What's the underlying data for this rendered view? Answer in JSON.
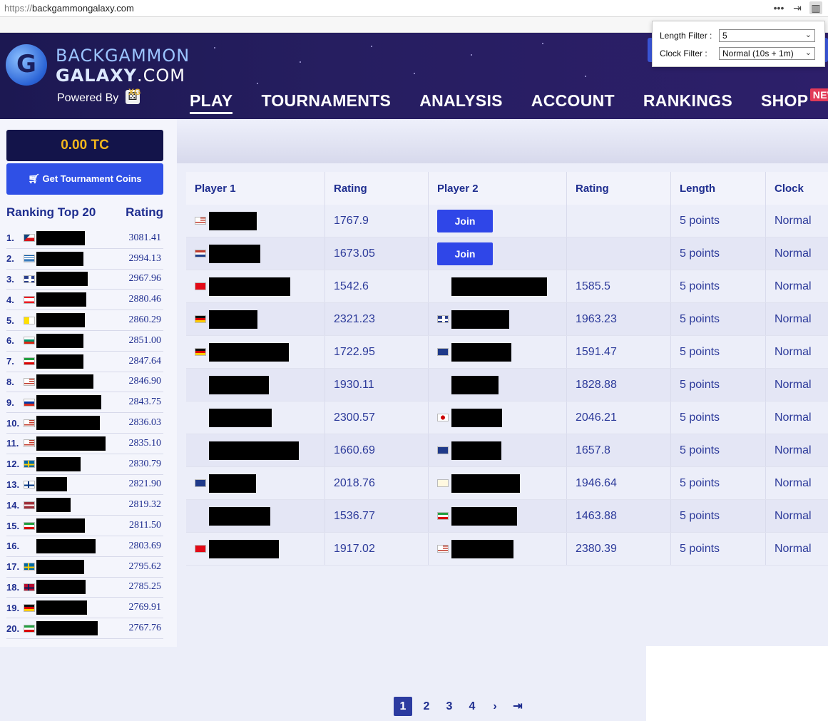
{
  "browser": {
    "url_proto": "https://",
    "url_host": "backgammongalaxy.com",
    "menu_icon": "more-icon",
    "icons": [
      "more-icon",
      "exit-icon",
      "extension-icon"
    ]
  },
  "header": {
    "logo_line1": "BACKGAMMON",
    "logo_line2_a": "GALAXY",
    "logo_line2_b": ".COM",
    "powered_by": "Powered By",
    "xg": "XG",
    "nav": [
      {
        "label": "PLAY"
      },
      {
        "label": "TOURNAMENTS"
      },
      {
        "label": "ANALYSIS"
      },
      {
        "label": "ACCOUNT"
      },
      {
        "label": "RANKINGS"
      },
      {
        "label": "SHOP"
      }
    ],
    "shop_badge": "NEW"
  },
  "filters": {
    "length_label": "Length Filter :",
    "length_value": "5",
    "clock_label": "Clock Filter :",
    "clock_value": "Normal (10s + 1m)"
  },
  "sidebar": {
    "balance": "0.00 TC",
    "coins_button": "Get Tournament Coins",
    "ranking_title": "Ranking Top 20",
    "rating_title": "Rating",
    "rankings": [
      {
        "rank": "1.",
        "flag": "CZ",
        "rating": "3081.41"
      },
      {
        "rank": "2.",
        "flag": "GR",
        "rating": "2994.13"
      },
      {
        "rank": "3.",
        "flag": "GB",
        "rating": "2967.96"
      },
      {
        "rank": "4.",
        "flag": "LB",
        "rating": "2880.46"
      },
      {
        "rank": "5.",
        "flag": "VA",
        "rating": "2860.29"
      },
      {
        "rank": "6.",
        "flag": "BG",
        "rating": "2851.00"
      },
      {
        "rank": "7.",
        "flag": "IR",
        "rating": "2847.64"
      },
      {
        "rank": "8.",
        "flag": "US",
        "rating": "2846.90"
      },
      {
        "rank": "9.",
        "flag": "RU",
        "rating": "2843.75"
      },
      {
        "rank": "10.",
        "flag": "US",
        "rating": "2836.03"
      },
      {
        "rank": "11.",
        "flag": "US",
        "rating": "2835.10"
      },
      {
        "rank": "12.",
        "flag": "SE",
        "rating": "2830.79"
      },
      {
        "rank": "13.",
        "flag": "FI",
        "rating": "2821.90"
      },
      {
        "rank": "14.",
        "flag": "LV",
        "rating": "2819.32"
      },
      {
        "rank": "15.",
        "flag": "IR",
        "rating": "2811.50"
      },
      {
        "rank": "16.",
        "flag": "",
        "rating": "2803.69"
      },
      {
        "rank": "17.",
        "flag": "SE",
        "rating": "2795.62"
      },
      {
        "rank": "18.",
        "flag": "NO",
        "rating": "2785.25"
      },
      {
        "rank": "19.",
        "flag": "DE",
        "rating": "2769.91"
      },
      {
        "rank": "20.",
        "flag": "IR",
        "rating": "2767.76"
      }
    ]
  },
  "games": {
    "headers": [
      "Player 1",
      "Rating",
      "Player 2",
      "Rating",
      "Length",
      "Clock"
    ],
    "join_label": "Join",
    "rows": [
      {
        "p1_flag": "US",
        "p1_rating": "1767.9",
        "p2_join": true,
        "p2_flag": "",
        "p2_rating": "",
        "length": "5 points",
        "clock": "Normal"
      },
      {
        "p1_flag": "NL",
        "p1_rating": "1673.05",
        "p2_join": true,
        "p2_flag": "",
        "p2_rating": "",
        "length": "5 points",
        "clock": "Normal"
      },
      {
        "p1_flag": "TR",
        "p1_rating": "1542.6",
        "p2_join": false,
        "p2_flag": "",
        "p2_rating": "1585.5",
        "length": "5 points",
        "clock": "Normal"
      },
      {
        "p1_flag": "DE",
        "p1_rating": "2321.23",
        "p2_join": false,
        "p2_flag": "GB",
        "p2_rating": "1963.23",
        "length": "5 points",
        "clock": "Normal"
      },
      {
        "p1_flag": "DE",
        "p1_rating": "1722.95",
        "p2_join": false,
        "p2_flag": "AU",
        "p2_rating": "1591.47",
        "length": "5 points",
        "clock": "Normal"
      },
      {
        "p1_flag": "",
        "p1_rating": "1930.11",
        "p2_join": false,
        "p2_flag": "",
        "p2_rating": "1828.88",
        "length": "5 points",
        "clock": "Normal"
      },
      {
        "p1_flag": "",
        "p1_rating": "2300.57",
        "p2_join": false,
        "p2_flag": "JP",
        "p2_rating": "2046.21",
        "length": "5 points",
        "clock": "Normal"
      },
      {
        "p1_flag": "",
        "p1_rating": "1660.69",
        "p2_join": false,
        "p2_flag": "AU",
        "p2_rating": "1657.8",
        "length": "5 points",
        "clock": "Normal"
      },
      {
        "p1_flag": "AU",
        "p1_rating": "2018.76",
        "p2_join": false,
        "p2_flag": "CY",
        "p2_rating": "1946.64",
        "length": "5 points",
        "clock": "Normal"
      },
      {
        "p1_flag": "",
        "p1_rating": "1536.77",
        "p2_join": false,
        "p2_flag": "IR",
        "p2_rating": "1463.88",
        "length": "5 points",
        "clock": "Normal"
      },
      {
        "p1_flag": "TR",
        "p1_rating": "1917.02",
        "p2_join": false,
        "p2_flag": "US",
        "p2_rating": "2380.39",
        "length": "5 points",
        "clock": "Normal"
      }
    ]
  },
  "pagination": {
    "pages": [
      "1",
      "2",
      "3",
      "4"
    ],
    "current": "1",
    "next_icon": "chevron-right-icon",
    "last_icon": "last-page-icon"
  }
}
